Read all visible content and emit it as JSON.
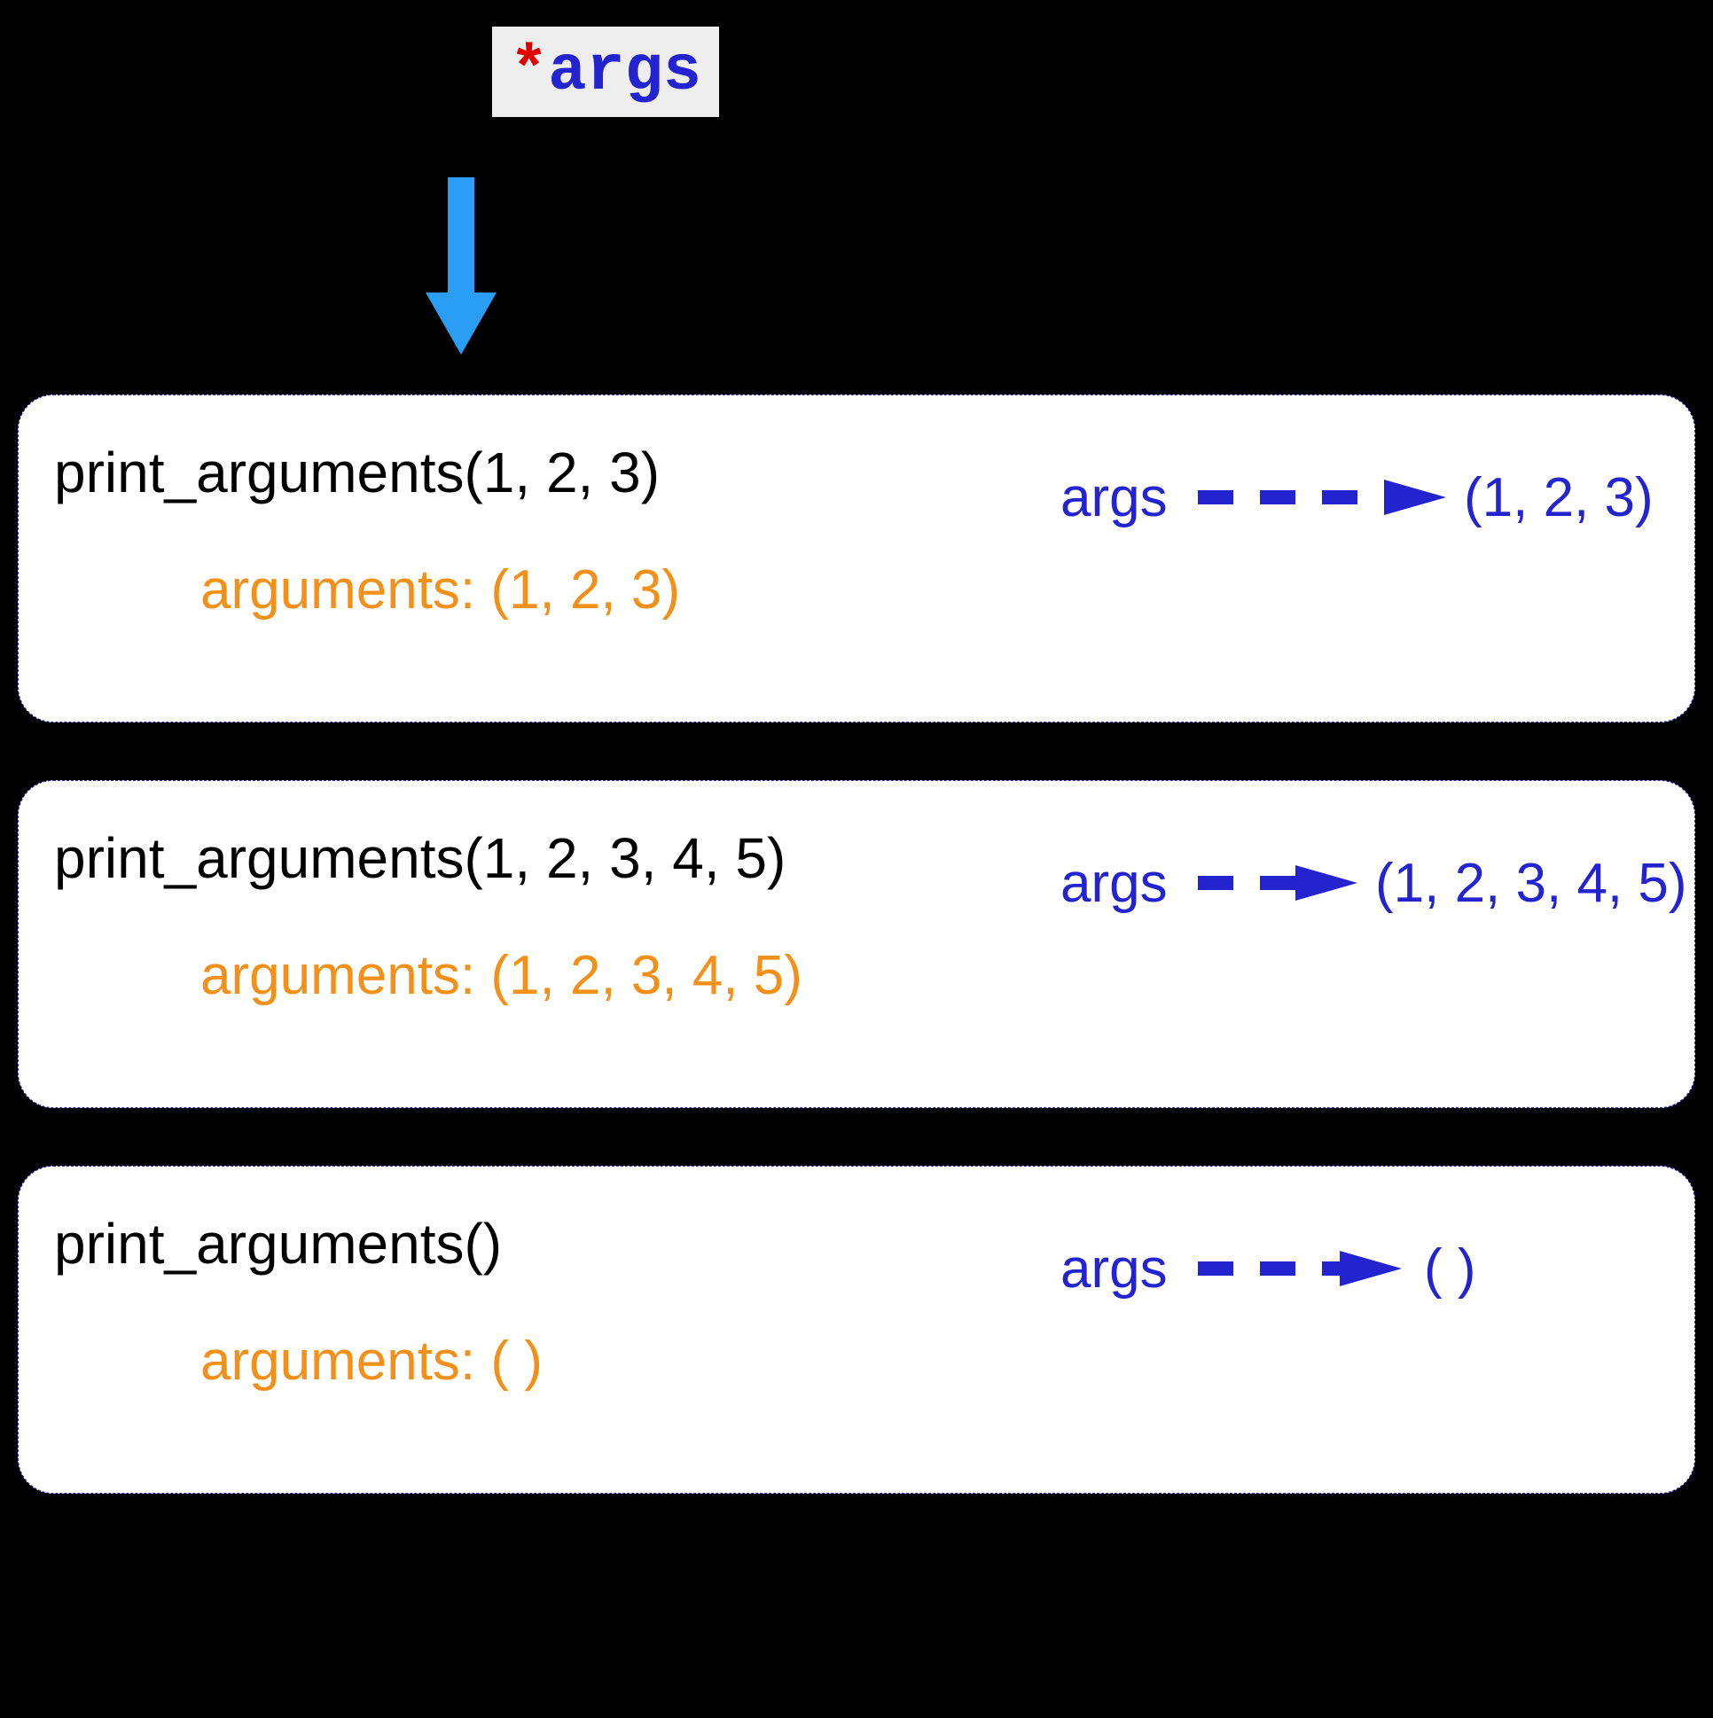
{
  "code": {
    "star": "*",
    "args_kw": "args"
  },
  "examples": [
    {
      "call": "print_arguments(1, 2, 3)",
      "output": "arguments: (1, 2, 3)",
      "args_label": "args",
      "tuple": "(1, 2, 3)"
    },
    {
      "call": "print_arguments(1, 2, 3, 4, 5)",
      "output": "arguments: (1, 2, 3, 4, 5)",
      "args_label": "args",
      "tuple": "(1, 2, 3, 4, 5)"
    },
    {
      "call": "print_arguments()",
      "output": "arguments: ( )",
      "args_label": "args",
      "tuple": "( )"
    }
  ]
}
